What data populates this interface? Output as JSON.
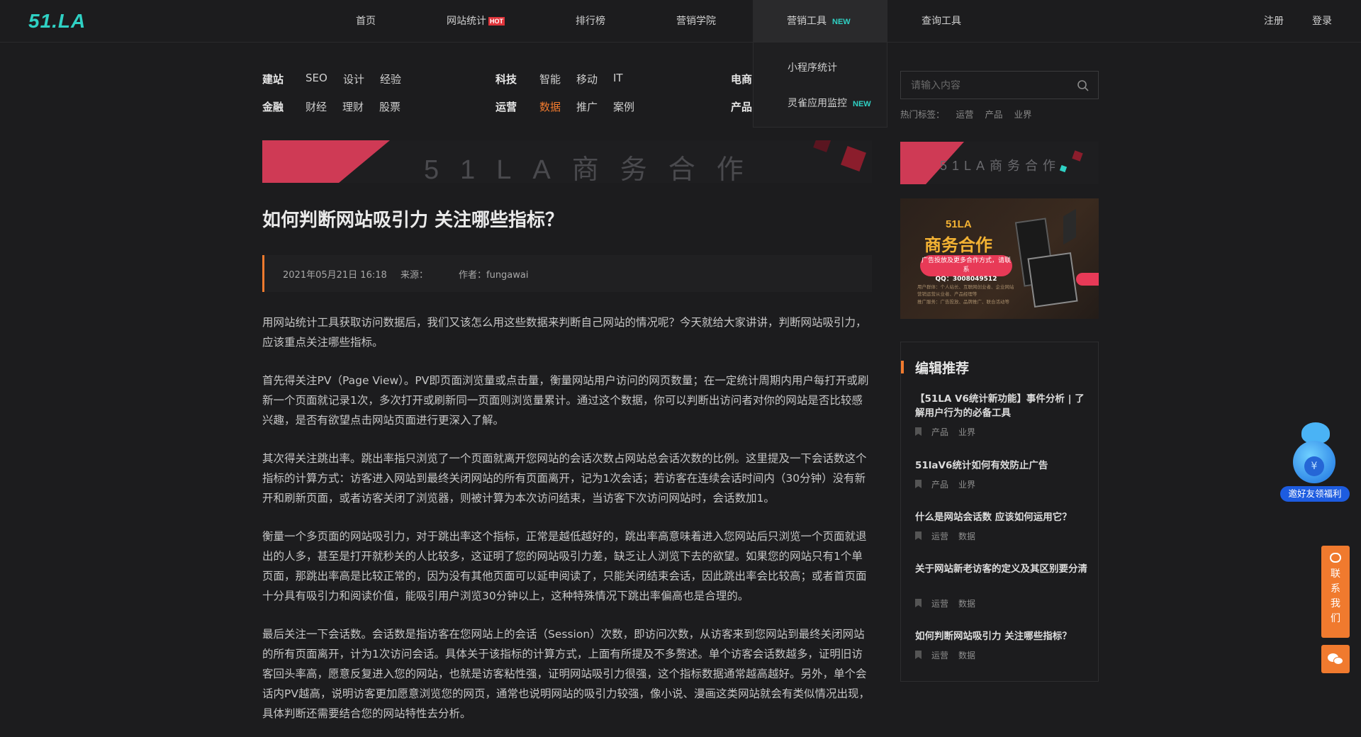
{
  "header": {
    "logo": "51.LA",
    "nav": [
      {
        "label": "首页"
      },
      {
        "label": "网站统计",
        "badge": "HOT"
      },
      {
        "label": "排行榜"
      },
      {
        "label": "营销学院"
      },
      {
        "label": "营销工具",
        "badge": "NEW"
      },
      {
        "label": "查询工具"
      }
    ],
    "register": "注册",
    "login": "登录"
  },
  "dropdown": {
    "items": [
      {
        "label": "小程序统计"
      },
      {
        "label": "灵雀应用监控",
        "badge": "NEW"
      }
    ]
  },
  "categories": {
    "groups": [
      {
        "label": "建站",
        "items": [
          "SEO",
          "设计",
          "经验"
        ]
      },
      {
        "label": "科技",
        "items": [
          "智能",
          "移动",
          "IT"
        ]
      },
      {
        "label": "电商",
        "items": []
      },
      {
        "label": "金融",
        "items": [
          "财经",
          "理财",
          "股票"
        ]
      },
      {
        "label": "运营",
        "items": [
          "数据",
          "推广",
          "案例"
        ]
      },
      {
        "label": "产品",
        "items": []
      }
    ],
    "active": "数据"
  },
  "banner": {
    "text": "51LA商务合作"
  },
  "article": {
    "title": "如何判断网站吸引力 关注哪些指标？",
    "date": "2021年05月21日 16:18",
    "source_label": "来源：",
    "author": "作者：fungawai",
    "paragraphs": [
      "用网站统计工具获取访问数据后，我们又该怎么用这些数据来判断自己网站的情况呢？今天就给大家讲讲，判断网站吸引力，应该重点关注哪些指标。",
      "首先得关注PV（Page View）。PV即页面浏览量或点击量，衡量网站用户访问的网页数量；在一定统计周期内用户每打开或刷新一个页面就记录1次，多次打开或刷新同一页面则浏览量累计。通过这个数据，你可以判断出访问者对你的网站是否比较感兴趣，是否有欲望点击网站页面进行更深入了解。",
      "其次得关注跳出率。跳出率指只浏览了一个页面就离开您网站的会话次数占网站总会话次数的比例。这里提及一下会话数这个指标的计算方式：访客进入网站到最终关闭网站的所有页面离开，记为1次会话；若访客在连续会话时间内（30分钟）没有新开和刷新页面，或者访客关闭了浏览器，则被计算为本次访问结束，当访客下次访问网站时，会话数加1。",
      "衡量一个多页面的网站吸引力，对于跳出率这个指标，正常是越低越好的，跳出率高意味着进入您网站后只浏览一个页面就退出的人多，甚至是打开就秒关的人比较多，这证明了您的网站吸引力差，缺乏让人浏览下去的欲望。如果您的网站只有1个单页面，那跳出率高是比较正常的，因为没有其他页面可以延申阅读了，只能关闭结束会话，因此跳出率会比较高；或者首页面十分具有吸引力和阅读价值，能吸引用户浏览30分钟以上，这种特殊情况下跳出率偏高也是合理的。",
      "最后关注一下会话数。会话数是指访客在您网站上的会话（Session）次数，即访问次数，从访客来到您网站到最终关闭网站的所有页面离开，计为1次访问会话。具体关于该指标的计算方式，上面有所提及不多赘述。单个访客会话数越多，证明旧访客回头率高，愿意反复进入您的网站，也就是访客粘性强，证明网站吸引力很强，这个指标数据通常越高越好。另外，单个会话内PV越高，说明访客更加愿意浏览您的网页，通常也说明网站的吸引力较强，像小说、漫画这类网站就会有类似情况出现，具体判断还需要结合您的网站特性去分析。"
    ]
  },
  "sidebar": {
    "search_placeholder": "请输入内容",
    "hot_tags_label": "热门标签：",
    "hot_tags": [
      "运营",
      "产品",
      "业界"
    ],
    "banner_text": "51LA商务合作",
    "ad": {
      "brand": "51LA",
      "headline": "商务合作",
      "pill_line1": "广告投放及更多合作方式，请联系",
      "pill_line2": "QQ：3008049512",
      "note1": "用户群体：个人站长、互联网创业者、企业网站营销运营从业者、产品经理等",
      "note2": "推广服务：广告投放、品牌推广、联合活动等"
    },
    "picks_title": "编辑推荐",
    "picks": [
      {
        "title": "【51LA V6统计新功能】事件分析 | 了解用户行为的必备工具",
        "tags": [
          "产品",
          "业界"
        ]
      },
      {
        "title": "51laV6统计如何有效防止广告",
        "tags": [
          "产品",
          "业界"
        ]
      },
      {
        "title": "什么是网站会话数 应该如何运用它？",
        "tags": [
          "运营",
          "数据"
        ]
      },
      {
        "title": "关于网站新老访客的定义及其区别要分清",
        "tags": [
          "运营",
          "数据"
        ]
      },
      {
        "title": "如何判断网站吸引力 关注哪些指标？",
        "tags": [
          "运营",
          "数据"
        ]
      }
    ]
  },
  "floating": {
    "mascot_coin": "¥",
    "mascot_label": "邀好友领福利",
    "contact_label": "联系我们"
  },
  "colors": {
    "accent": "#f07a2e",
    "brand": "#2fd1c4",
    "background": "#1c1c1e"
  }
}
